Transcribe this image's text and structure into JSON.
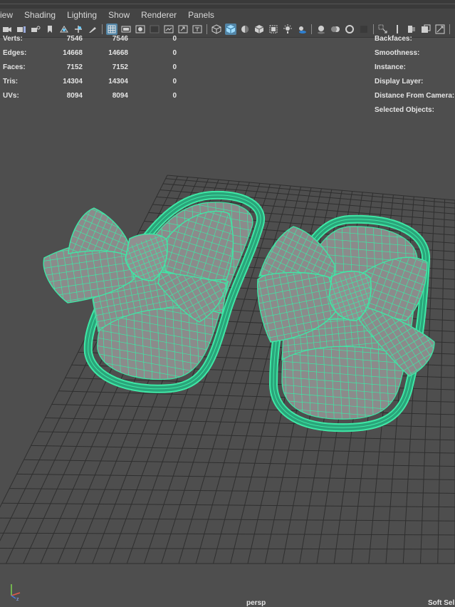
{
  "menu": [
    "View",
    "Shading",
    "Lighting",
    "Show",
    "Renderer",
    "Panels"
  ],
  "menu_display": [
    "iew",
    "Shading",
    "Lighting",
    "Show",
    "Renderer",
    "Panels"
  ],
  "hud_left": [
    {
      "label": "Verts:",
      "v1": "7546",
      "v2": "7546",
      "v3": "0"
    },
    {
      "label": "Edges:",
      "v1": "14668",
      "v2": "14668",
      "v3": "0"
    },
    {
      "label": "Faces:",
      "v1": "7152",
      "v2": "7152",
      "v3": "0"
    },
    {
      "label": "Tris:",
      "v1": "14304",
      "v2": "14304",
      "v3": "0"
    },
    {
      "label": "UVs:",
      "v1": "8094",
      "v2": "8094",
      "v3": "0"
    }
  ],
  "hud_right": [
    "Backfaces:",
    "Smoothness:",
    "Instance:",
    "Display Layer:",
    "Distance From Camera:",
    "Selected Objects:"
  ],
  "camera_label": "persp",
  "soft_select_label": "Soft Sel",
  "colors": {
    "wireframe_selected": "#3ee8a6",
    "mesh_fill": "#8b8b8b",
    "grid_line": "#2f2f2f",
    "viewport_bg": "#4e4e4e",
    "active_button": "#5285a6"
  },
  "toolbar_icons": [
    "camera-select-icon",
    "camera-attr-icon",
    "bookmark-icon",
    "image-plane-icon",
    "2d-pan-icon",
    "grease-pencil-icon",
    "grid-icon",
    "film-gate-icon",
    "resolution-gate-icon",
    "gate-mask-icon",
    "field-chart-icon",
    "safe-action-icon",
    "safe-title-icon",
    "wireframe-icon",
    "smooth-shade-icon",
    "default-material-icon",
    "wireframe-on-shaded-icon",
    "xray-icon",
    "lights-icon",
    "shadows-icon",
    "ambient-occlusion-icon",
    "motion-blur-icon",
    "anti-aliasing-icon",
    "depth-of-field-icon",
    "isolate-select-icon",
    "xray-joints-icon",
    "xray-active-icon",
    "backface-culling-icon",
    "texture-icon",
    "color-mgmt-icon"
  ]
}
